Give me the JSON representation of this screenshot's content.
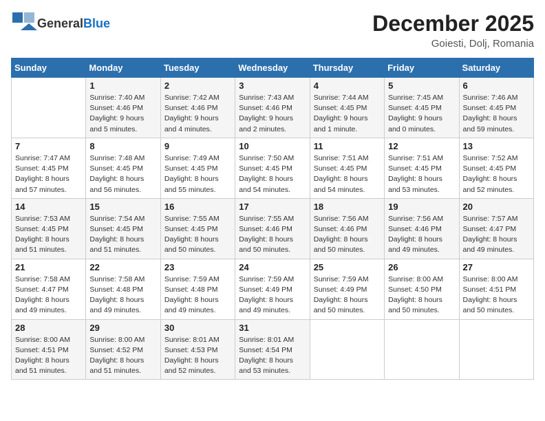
{
  "header": {
    "logo_general": "General",
    "logo_blue": "Blue",
    "month": "December 2025",
    "location": "Goiesti, Dolj, Romania"
  },
  "weekdays": [
    "Sunday",
    "Monday",
    "Tuesday",
    "Wednesday",
    "Thursday",
    "Friday",
    "Saturday"
  ],
  "weeks": [
    [
      {
        "date": "",
        "info": ""
      },
      {
        "date": "1",
        "info": "Sunrise: 7:40 AM\nSunset: 4:46 PM\nDaylight: 9 hours\nand 5 minutes."
      },
      {
        "date": "2",
        "info": "Sunrise: 7:42 AM\nSunset: 4:46 PM\nDaylight: 9 hours\nand 4 minutes."
      },
      {
        "date": "3",
        "info": "Sunrise: 7:43 AM\nSunset: 4:46 PM\nDaylight: 9 hours\nand 2 minutes."
      },
      {
        "date": "4",
        "info": "Sunrise: 7:44 AM\nSunset: 4:45 PM\nDaylight: 9 hours\nand 1 minute."
      },
      {
        "date": "5",
        "info": "Sunrise: 7:45 AM\nSunset: 4:45 PM\nDaylight: 9 hours\nand 0 minutes."
      },
      {
        "date": "6",
        "info": "Sunrise: 7:46 AM\nSunset: 4:45 PM\nDaylight: 8 hours\nand 59 minutes."
      }
    ],
    [
      {
        "date": "7",
        "info": "Sunrise: 7:47 AM\nSunset: 4:45 PM\nDaylight: 8 hours\nand 57 minutes."
      },
      {
        "date": "8",
        "info": "Sunrise: 7:48 AM\nSunset: 4:45 PM\nDaylight: 8 hours\nand 56 minutes."
      },
      {
        "date": "9",
        "info": "Sunrise: 7:49 AM\nSunset: 4:45 PM\nDaylight: 8 hours\nand 55 minutes."
      },
      {
        "date": "10",
        "info": "Sunrise: 7:50 AM\nSunset: 4:45 PM\nDaylight: 8 hours\nand 54 minutes."
      },
      {
        "date": "11",
        "info": "Sunrise: 7:51 AM\nSunset: 4:45 PM\nDaylight: 8 hours\nand 54 minutes."
      },
      {
        "date": "12",
        "info": "Sunrise: 7:51 AM\nSunset: 4:45 PM\nDaylight: 8 hours\nand 53 minutes."
      },
      {
        "date": "13",
        "info": "Sunrise: 7:52 AM\nSunset: 4:45 PM\nDaylight: 8 hours\nand 52 minutes."
      }
    ],
    [
      {
        "date": "14",
        "info": "Sunrise: 7:53 AM\nSunset: 4:45 PM\nDaylight: 8 hours\nand 51 minutes."
      },
      {
        "date": "15",
        "info": "Sunrise: 7:54 AM\nSunset: 4:45 PM\nDaylight: 8 hours\nand 51 minutes."
      },
      {
        "date": "16",
        "info": "Sunrise: 7:55 AM\nSunset: 4:45 PM\nDaylight: 8 hours\nand 50 minutes."
      },
      {
        "date": "17",
        "info": "Sunrise: 7:55 AM\nSunset: 4:46 PM\nDaylight: 8 hours\nand 50 minutes."
      },
      {
        "date": "18",
        "info": "Sunrise: 7:56 AM\nSunset: 4:46 PM\nDaylight: 8 hours\nand 50 minutes."
      },
      {
        "date": "19",
        "info": "Sunrise: 7:56 AM\nSunset: 4:46 PM\nDaylight: 8 hours\nand 49 minutes."
      },
      {
        "date": "20",
        "info": "Sunrise: 7:57 AM\nSunset: 4:47 PM\nDaylight: 8 hours\nand 49 minutes."
      }
    ],
    [
      {
        "date": "21",
        "info": "Sunrise: 7:58 AM\nSunset: 4:47 PM\nDaylight: 8 hours\nand 49 minutes."
      },
      {
        "date": "22",
        "info": "Sunrise: 7:58 AM\nSunset: 4:48 PM\nDaylight: 8 hours\nand 49 minutes."
      },
      {
        "date": "23",
        "info": "Sunrise: 7:59 AM\nSunset: 4:48 PM\nDaylight: 8 hours\nand 49 minutes."
      },
      {
        "date": "24",
        "info": "Sunrise: 7:59 AM\nSunset: 4:49 PM\nDaylight: 8 hours\nand 49 minutes."
      },
      {
        "date": "25",
        "info": "Sunrise: 7:59 AM\nSunset: 4:49 PM\nDaylight: 8 hours\nand 50 minutes."
      },
      {
        "date": "26",
        "info": "Sunrise: 8:00 AM\nSunset: 4:50 PM\nDaylight: 8 hours\nand 50 minutes."
      },
      {
        "date": "27",
        "info": "Sunrise: 8:00 AM\nSunset: 4:51 PM\nDaylight: 8 hours\nand 50 minutes."
      }
    ],
    [
      {
        "date": "28",
        "info": "Sunrise: 8:00 AM\nSunset: 4:51 PM\nDaylight: 8 hours\nand 51 minutes."
      },
      {
        "date": "29",
        "info": "Sunrise: 8:00 AM\nSunset: 4:52 PM\nDaylight: 8 hours\nand 51 minutes."
      },
      {
        "date": "30",
        "info": "Sunrise: 8:01 AM\nSunset: 4:53 PM\nDaylight: 8 hours\nand 52 minutes."
      },
      {
        "date": "31",
        "info": "Sunrise: 8:01 AM\nSunset: 4:54 PM\nDaylight: 8 hours\nand 53 minutes."
      },
      {
        "date": "",
        "info": ""
      },
      {
        "date": "",
        "info": ""
      },
      {
        "date": "",
        "info": ""
      }
    ]
  ]
}
